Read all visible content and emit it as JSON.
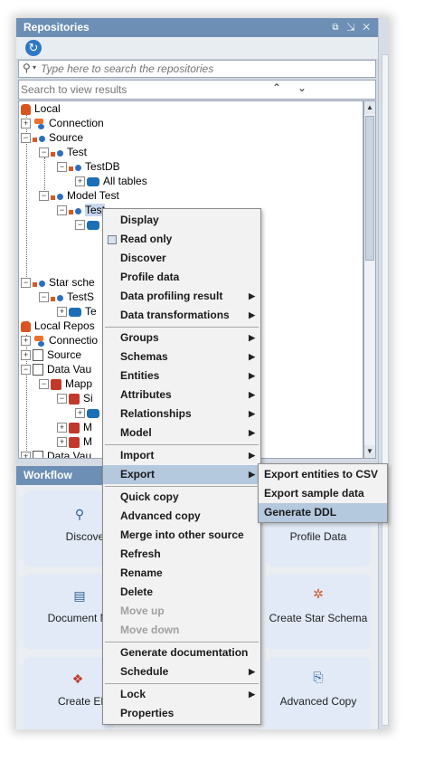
{
  "repositories": {
    "title": "Repositories",
    "window_controls": "⧉ ⇲ ✕",
    "search_placeholder": "Type here to search the repositories",
    "results_placeholder": "Search to view results",
    "tree": [
      {
        "label": "Local",
        "icon": "database-icon"
      },
      {
        "label": "Connection",
        "icon": "connection-icon"
      },
      {
        "label": "Source",
        "icon": "source-icon"
      },
      {
        "label": "Test",
        "icon": "source-icon"
      },
      {
        "label": "TestDB",
        "icon": "source-icon"
      },
      {
        "label": "All tables",
        "icon": "table-icon"
      },
      {
        "label": "Model Test",
        "icon": "source-icon"
      },
      {
        "label": "Test",
        "icon": "source-icon"
      },
      {
        "label": "",
        "icon": "table-icon"
      },
      {
        "label": "Star sche",
        "icon": "star-schema-icon"
      },
      {
        "label": "TestS",
        "icon": "source-icon"
      },
      {
        "label": "Te",
        "icon": "table-icon"
      },
      {
        "label": "Local Repos",
        "icon": "database-icon"
      },
      {
        "label": "Connectio",
        "icon": "connection-icon"
      },
      {
        "label": "Source",
        "icon": "document-icon"
      },
      {
        "label": "Data Vau",
        "icon": "document-icon"
      },
      {
        "label": "Mapp",
        "icon": "vault-icon"
      },
      {
        "label": "Si",
        "icon": "vault-icon"
      },
      {
        "label": "",
        "icon": "table-icon"
      },
      {
        "label": "M",
        "icon": "vault-icon"
      },
      {
        "label": "M",
        "icon": "vault-icon"
      },
      {
        "label": "Data Vau",
        "icon": "document-icon"
      }
    ]
  },
  "workflow": {
    "title": "Workflow",
    "cards": [
      {
        "label": "Discover",
        "icon": "search-icon"
      },
      {
        "label": "Profile Data",
        "icon": ""
      },
      {
        "label": "Document Mo",
        "icon": "document-icon"
      },
      {
        "label": "Create Star Schema",
        "icon": "star-schema-icon"
      },
      {
        "label": "Create EDV",
        "icon": "edw-icon"
      },
      {
        "label": "Advanced Copy",
        "icon": "copy-icon"
      }
    ]
  },
  "context_menu": {
    "items": [
      {
        "label": "Display"
      },
      {
        "label": "Read only",
        "checkbox": true
      },
      {
        "label": "Discover"
      },
      {
        "label": "Profile data"
      },
      {
        "label": "Data profiling result",
        "submenu": true
      },
      {
        "label": "Data transformations",
        "submenu": true
      },
      {
        "label": "Groups",
        "submenu": true
      },
      {
        "label": "Schemas",
        "submenu": true
      },
      {
        "label": "Entities",
        "submenu": true
      },
      {
        "label": "Attributes",
        "submenu": true
      },
      {
        "label": "Relationships",
        "submenu": true
      },
      {
        "label": "Model",
        "submenu": true
      },
      {
        "label": "Import",
        "submenu": true
      },
      {
        "label": "Export",
        "submenu": true,
        "highlighted": true
      },
      {
        "label": "Quick copy"
      },
      {
        "label": "Advanced copy"
      },
      {
        "label": "Merge into other source"
      },
      {
        "label": "Refresh"
      },
      {
        "label": "Rename"
      },
      {
        "label": "Delete"
      },
      {
        "label": "Move up",
        "disabled": true
      },
      {
        "label": "Move down",
        "disabled": true
      },
      {
        "label": "Generate documentation"
      },
      {
        "label": "Schedule",
        "submenu": true
      },
      {
        "label": "Lock",
        "submenu": true
      },
      {
        "label": "Properties"
      }
    ]
  },
  "export_submenu": {
    "items": [
      {
        "label": "Export entities to CSV"
      },
      {
        "label": "Export sample data"
      },
      {
        "label": "Generate DDL",
        "highlighted": true
      }
    ]
  },
  "colors": {
    "header_blue": "#6d8fb5",
    "highlight": "#b4c8de",
    "card_bg": "#e1eaf6"
  }
}
